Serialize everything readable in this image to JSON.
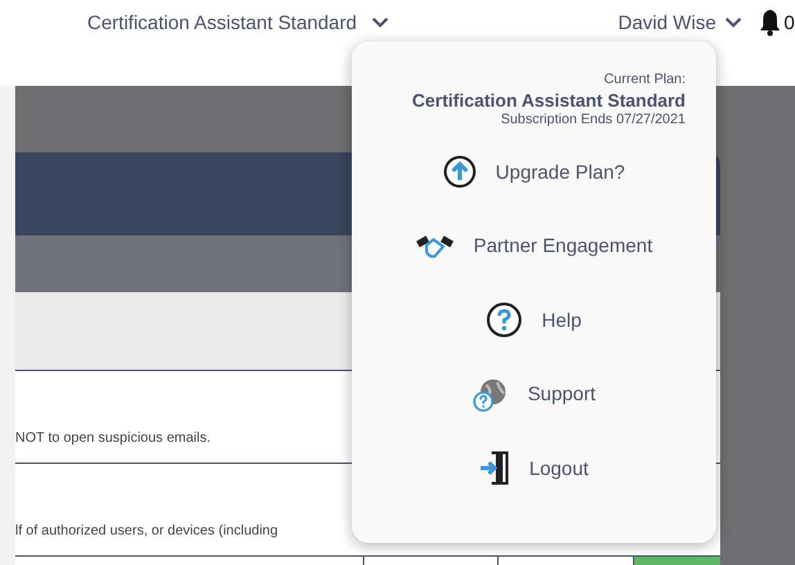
{
  "header": {
    "plan_selector": "Certification Assistant Standard",
    "user_menu": "David Wise",
    "notification_count": "0"
  },
  "table": {
    "rows": [
      {
        "text": "NOT to open suspicious emails."
      },
      {
        "text": "lf of authorized users, or devices (including"
      }
    ]
  },
  "account_menu": {
    "plan_label": "Current Plan:",
    "plan_name": "Certification Assistant Standard",
    "subscription": "Subscription Ends 07/27/2021",
    "items": [
      {
        "kind": "upgrade",
        "label": "Upgrade Plan?"
      },
      {
        "kind": "partner",
        "label": "Partner Engagement"
      },
      {
        "kind": "help",
        "label": "Help"
      },
      {
        "kind": "support",
        "label": "Support"
      },
      {
        "kind": "logout",
        "label": "Logout"
      }
    ]
  }
}
